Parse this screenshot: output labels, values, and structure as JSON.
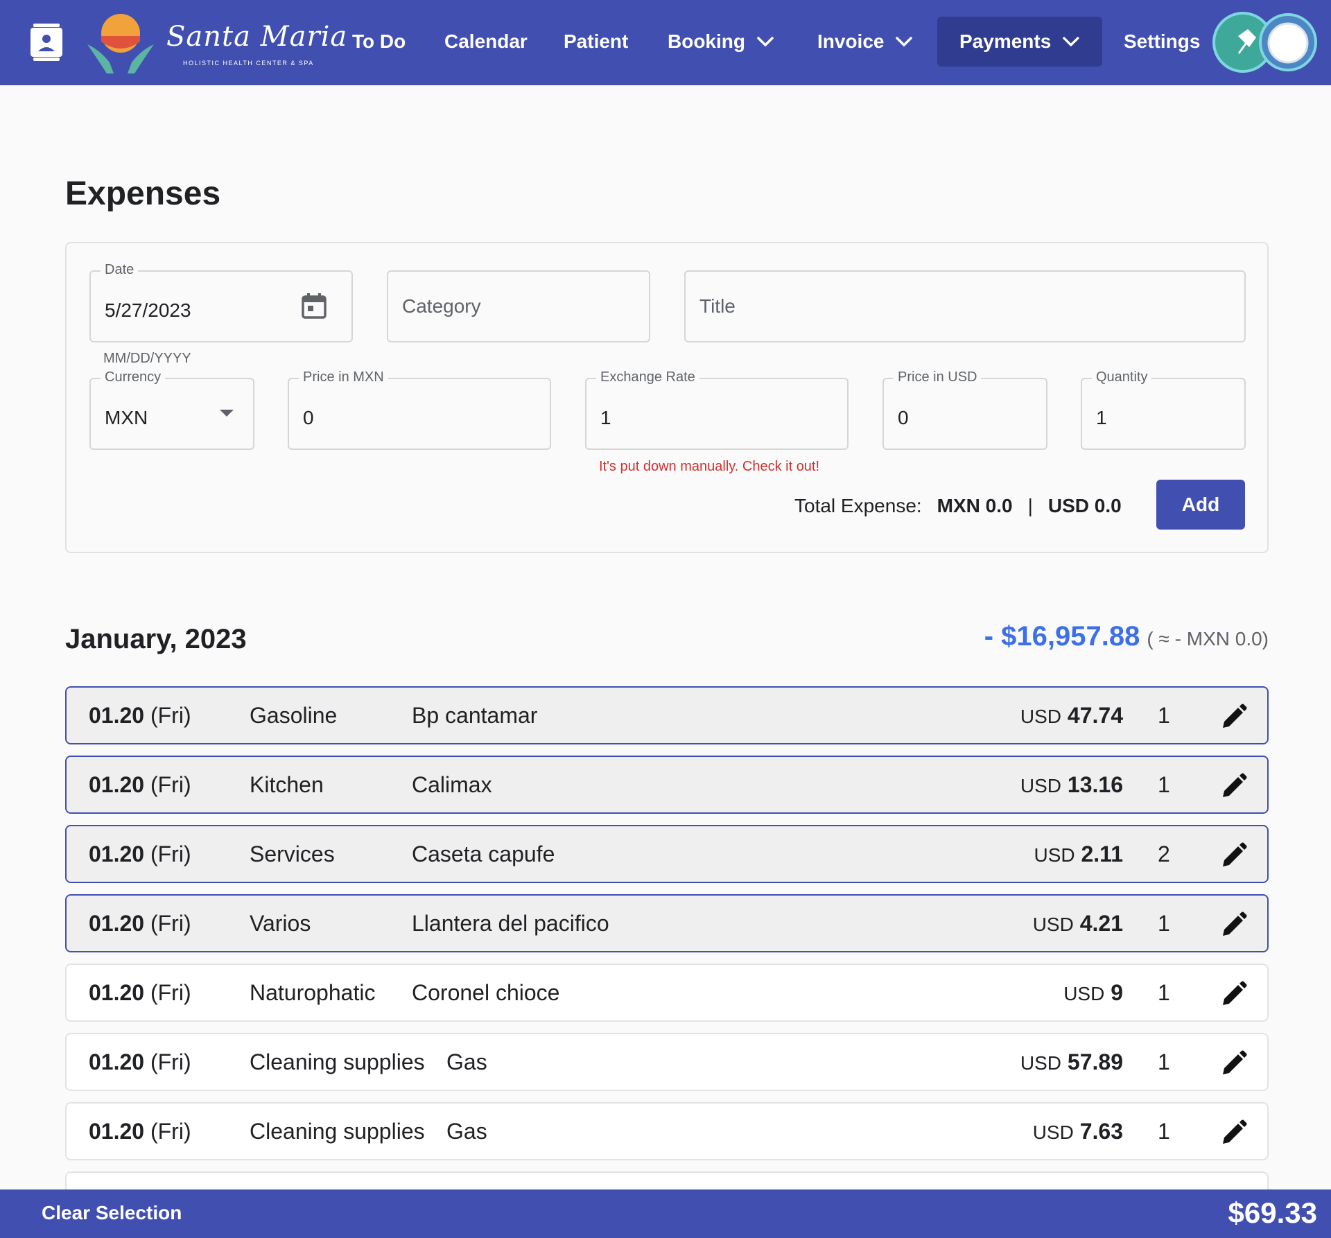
{
  "nav": {
    "logo": {
      "script": "Santa Maria",
      "subtitle": "HOLISTIC HEALTH CENTER & SPA"
    },
    "items": [
      {
        "label": "To Do"
      },
      {
        "label": "Calendar"
      },
      {
        "label": "Patient"
      },
      {
        "label": "Booking"
      },
      {
        "label": "Invoice"
      },
      {
        "label": "Payments"
      },
      {
        "label": "Settings"
      }
    ],
    "active_item": "Payments",
    "icons": [
      "contact-book-icon",
      "chevron-down-icon",
      "pin-icon",
      "user-avatar"
    ],
    "colors": {
      "bar": "#4150b0",
      "active": "#2f3c8f",
      "pin_avatar": "#3ea99a"
    }
  },
  "page": {
    "title": "Expenses"
  },
  "form": {
    "date": {
      "label": "Date",
      "value": "5/27/2023",
      "helper": "MM/DD/YYYY"
    },
    "category": {
      "placeholder": "Category"
    },
    "title": {
      "placeholder": "Title"
    },
    "currency": {
      "label": "Currency",
      "value": "MXN"
    },
    "price_mxn": {
      "label": "Price in MXN",
      "value": "0"
    },
    "exchange_rate": {
      "label": "Exchange Rate",
      "value": "1",
      "error": "It's put down manually. Check it out!"
    },
    "price_usd": {
      "label": "Price in USD",
      "value": "0"
    },
    "quantity": {
      "label": "Quantity",
      "value": "1"
    },
    "total": {
      "label": "Total Expense:",
      "mxn": "MXN 0.0",
      "separator": "|",
      "usd": "USD 0.0"
    },
    "add_label": "Add"
  },
  "month": {
    "title": "January, 2023",
    "sum": "- $16,957.88",
    "conversion": "( ≈ - MXN 0.0)",
    "rows": [
      {
        "date": "01.20",
        "day": "(Fri)",
        "category": "Gasoline",
        "title": "Bp cantamar",
        "currency": "USD",
        "amount": "47.74",
        "qty": "1",
        "selected": true
      },
      {
        "date": "01.20",
        "day": "(Fri)",
        "category": "Kitchen",
        "title": "Calimax",
        "currency": "USD",
        "amount": "13.16",
        "qty": "1",
        "selected": true
      },
      {
        "date": "01.20",
        "day": "(Fri)",
        "category": "Services",
        "title": "Caseta capufe",
        "currency": "USD",
        "amount": "2.11",
        "qty": "2",
        "selected": true
      },
      {
        "date": "01.20",
        "day": "(Fri)",
        "category": "Varios",
        "title": "Llantera del pacifico",
        "currency": "USD",
        "amount": "4.21",
        "qty": "1",
        "selected": true
      },
      {
        "date": "01.20",
        "day": "(Fri)",
        "category": "Naturophatic",
        "title": "Coronel chioce",
        "currency": "USD",
        "amount": "9",
        "qty": "1",
        "selected": false
      },
      {
        "date": "01.20",
        "day": "(Fri)",
        "category": "Cleaning supplies",
        "title": "Gas",
        "currency": "USD",
        "amount": "57.89",
        "qty": "1",
        "selected": false
      },
      {
        "date": "01.20",
        "day": "(Fri)",
        "category": "Cleaning supplies",
        "title": "Gas",
        "currency": "USD",
        "amount": "7.63",
        "qty": "1",
        "selected": false
      }
    ]
  },
  "bottom_bar": {
    "clear_label": "Clear Selection",
    "selected_total": "$69.33"
  }
}
